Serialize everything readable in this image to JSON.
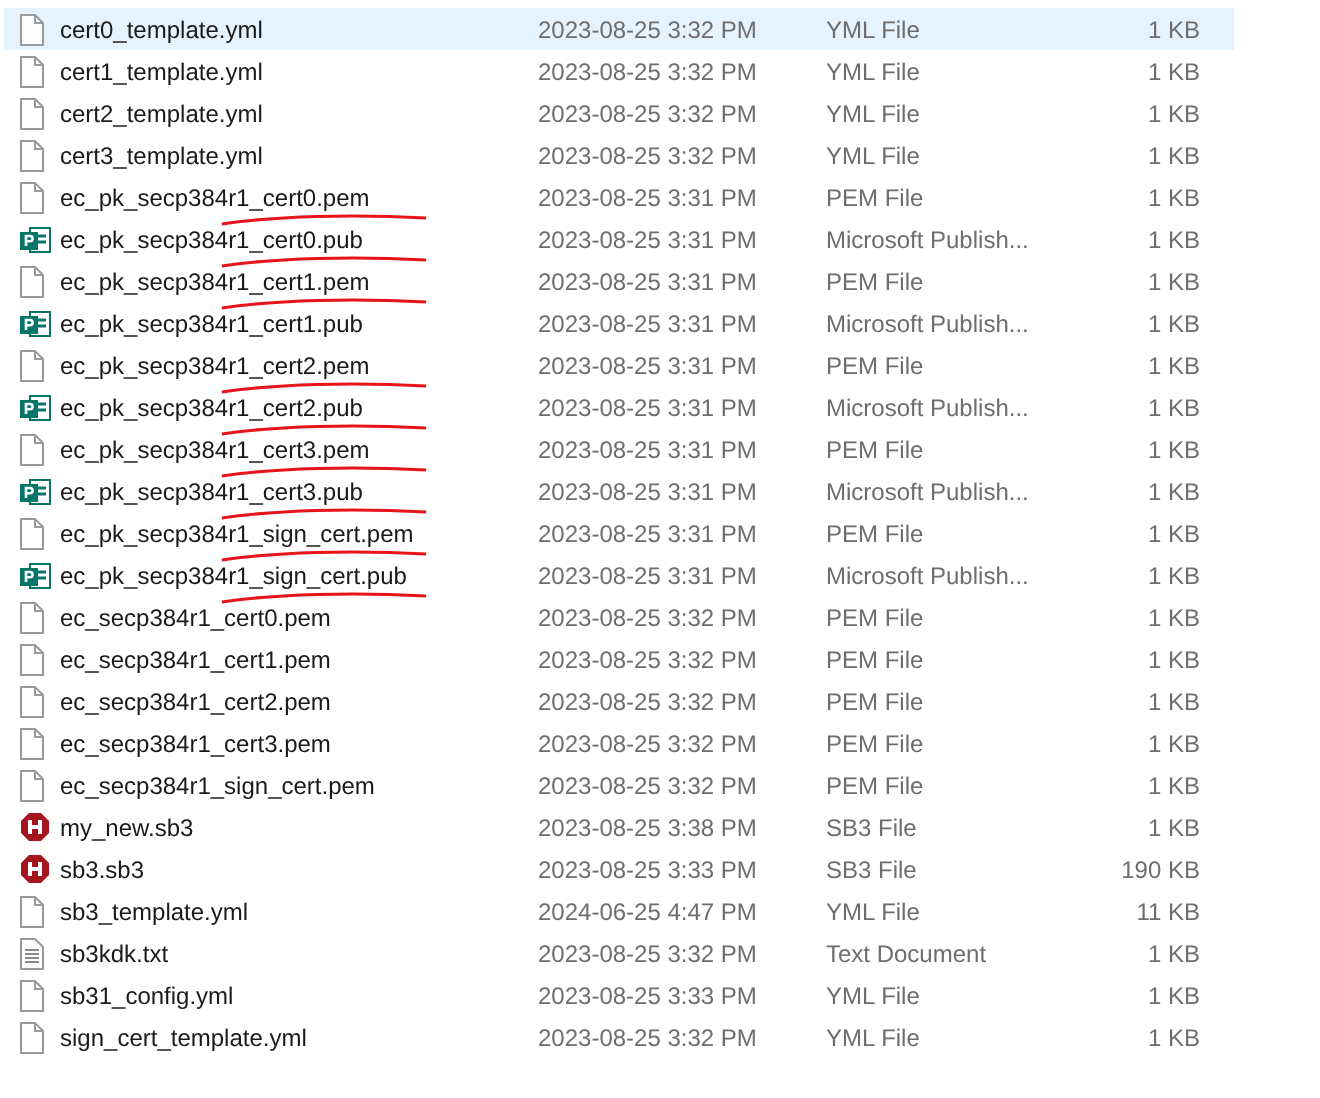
{
  "files": [
    {
      "name": "cert0_template.yml",
      "modified": "2023-08-25 3:32 PM",
      "type": "YML File",
      "size": "1 KB",
      "kind": "blank",
      "selected": true,
      "underlined": false
    },
    {
      "name": "cert1_template.yml",
      "modified": "2023-08-25 3:32 PM",
      "type": "YML File",
      "size": "1 KB",
      "kind": "blank",
      "selected": false,
      "underlined": false
    },
    {
      "name": "cert2_template.yml",
      "modified": "2023-08-25 3:32 PM",
      "type": "YML File",
      "size": "1 KB",
      "kind": "blank",
      "selected": false,
      "underlined": false
    },
    {
      "name": "cert3_template.yml",
      "modified": "2023-08-25 3:32 PM",
      "type": "YML File",
      "size": "1 KB",
      "kind": "blank",
      "selected": false,
      "underlined": false
    },
    {
      "name": "ec_pk_secp384r1_cert0.pem",
      "modified": "2023-08-25 3:31 PM",
      "type": "PEM File",
      "size": "1 KB",
      "kind": "blank",
      "selected": false,
      "underlined": true
    },
    {
      "name": "ec_pk_secp384r1_cert0.pub",
      "modified": "2023-08-25 3:31 PM",
      "type": "Microsoft Publish...",
      "size": "1 KB",
      "kind": "publisher",
      "selected": false,
      "underlined": true
    },
    {
      "name": "ec_pk_secp384r1_cert1.pem",
      "modified": "2023-08-25 3:31 PM",
      "type": "PEM File",
      "size": "1 KB",
      "kind": "blank",
      "selected": false,
      "underlined": true
    },
    {
      "name": "ec_pk_secp384r1_cert1.pub",
      "modified": "2023-08-25 3:31 PM",
      "type": "Microsoft Publish...",
      "size": "1 KB",
      "kind": "publisher",
      "selected": false,
      "underlined": false
    },
    {
      "name": "ec_pk_secp384r1_cert2.pem",
      "modified": "2023-08-25 3:31 PM",
      "type": "PEM File",
      "size": "1 KB",
      "kind": "blank",
      "selected": false,
      "underlined": true
    },
    {
      "name": "ec_pk_secp384r1_cert2.pub",
      "modified": "2023-08-25 3:31 PM",
      "type": "Microsoft Publish...",
      "size": "1 KB",
      "kind": "publisher",
      "selected": false,
      "underlined": true
    },
    {
      "name": "ec_pk_secp384r1_cert3.pem",
      "modified": "2023-08-25 3:31 PM",
      "type": "PEM File",
      "size": "1 KB",
      "kind": "blank",
      "selected": false,
      "underlined": true
    },
    {
      "name": "ec_pk_secp384r1_cert3.pub",
      "modified": "2023-08-25 3:31 PM",
      "type": "Microsoft Publish...",
      "size": "1 KB",
      "kind": "publisher",
      "selected": false,
      "underlined": true
    },
    {
      "name": "ec_pk_secp384r1_sign_cert.pem",
      "modified": "2023-08-25 3:31 PM",
      "type": "PEM File",
      "size": "1 KB",
      "kind": "blank",
      "selected": false,
      "underlined": true
    },
    {
      "name": "ec_pk_secp384r1_sign_cert.pub",
      "modified": "2023-08-25 3:31 PM",
      "type": "Microsoft Publish...",
      "size": "1 KB",
      "kind": "publisher",
      "selected": false,
      "underlined": true
    },
    {
      "name": "ec_secp384r1_cert0.pem",
      "modified": "2023-08-25 3:32 PM",
      "type": "PEM File",
      "size": "1 KB",
      "kind": "blank",
      "selected": false,
      "underlined": false
    },
    {
      "name": "ec_secp384r1_cert1.pem",
      "modified": "2023-08-25 3:32 PM",
      "type": "PEM File",
      "size": "1 KB",
      "kind": "blank",
      "selected": false,
      "underlined": false
    },
    {
      "name": "ec_secp384r1_cert2.pem",
      "modified": "2023-08-25 3:32 PM",
      "type": "PEM File",
      "size": "1 KB",
      "kind": "blank",
      "selected": false,
      "underlined": false
    },
    {
      "name": "ec_secp384r1_cert3.pem",
      "modified": "2023-08-25 3:32 PM",
      "type": "PEM File",
      "size": "1 KB",
      "kind": "blank",
      "selected": false,
      "underlined": false
    },
    {
      "name": "ec_secp384r1_sign_cert.pem",
      "modified": "2023-08-25 3:32 PM",
      "type": "PEM File",
      "size": "1 KB",
      "kind": "blank",
      "selected": false,
      "underlined": false
    },
    {
      "name": "my_new.sb3",
      "modified": "2023-08-25 3:38 PM",
      "type": "SB3 File",
      "size": "1 KB",
      "kind": "sb3",
      "selected": false,
      "underlined": false
    },
    {
      "name": "sb3.sb3",
      "modified": "2023-08-25 3:33 PM",
      "type": "SB3 File",
      "size": "190 KB",
      "kind": "sb3",
      "selected": false,
      "underlined": false
    },
    {
      "name": "sb3_template.yml",
      "modified": "2024-06-25 4:47 PM",
      "type": "YML File",
      "size": "11 KB",
      "kind": "blank",
      "selected": false,
      "underlined": false
    },
    {
      "name": "sb3kdk.txt",
      "modified": "2023-08-25 3:32 PM",
      "type": "Text Document",
      "size": "1 KB",
      "kind": "text",
      "selected": false,
      "underlined": false
    },
    {
      "name": "sb31_config.yml",
      "modified": "2023-08-25 3:33 PM",
      "type": "YML File",
      "size": "1 KB",
      "kind": "blank",
      "selected": false,
      "underlined": false
    },
    {
      "name": "sign_cert_template.yml",
      "modified": "2023-08-25 3:32 PM",
      "type": "YML File",
      "size": "1 KB",
      "kind": "blank",
      "selected": false,
      "underlined": false
    }
  ]
}
